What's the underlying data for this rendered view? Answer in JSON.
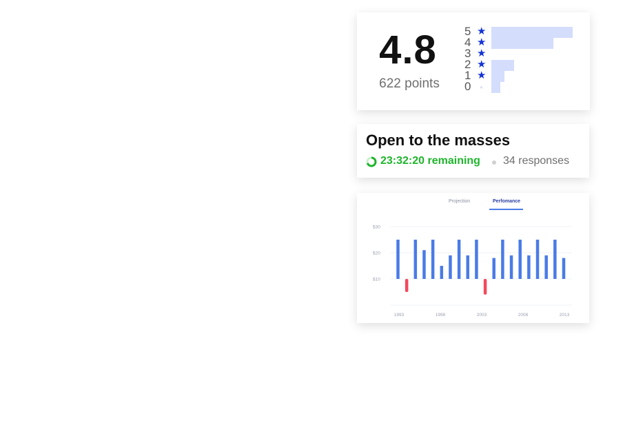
{
  "rating": {
    "score": "4.8",
    "points": "622 points",
    "rows": [
      {
        "label": "5",
        "star": "filled",
        "fraction": 1.0
      },
      {
        "label": "4",
        "star": "filled",
        "fraction": 0.76
      },
      {
        "label": "3",
        "star": "filled",
        "fraction": 0.0
      },
      {
        "label": "2",
        "star": "filled",
        "fraction": 0.28
      },
      {
        "label": "1",
        "star": "filled",
        "fraction": 0.16
      },
      {
        "label": "0",
        "star": "empty",
        "fraction": 0.11
      }
    ],
    "colors": {
      "star": "#1333d6",
      "bar": "#d4ddfb"
    }
  },
  "poll": {
    "title": "Open to the masses",
    "remaining": "23:32:20 remaining",
    "responses": "34 responses",
    "colors": {
      "remaining": "#1fb42c"
    }
  },
  "chart_tabs": {
    "projection": "Projection",
    "performance": "Perfomance",
    "active": "Perfomance"
  },
  "chart_data": {
    "type": "bar",
    "title": "",
    "xlabel": "",
    "ylabel": "",
    "x_tick_labels": [
      "1993",
      "1998",
      "2003",
      "2008",
      "2013"
    ],
    "y_tick_labels": [
      "$30",
      "$20",
      "$10"
    ],
    "y_ticks": [
      30,
      20,
      10
    ],
    "ylim": [
      0,
      32
    ],
    "baseline": 10,
    "grid": true,
    "values": [
      25,
      5,
      25,
      21,
      25,
      15,
      19,
      25,
      19,
      25,
      4,
      18,
      25,
      19,
      25,
      19,
      25,
      19,
      25,
      18
    ],
    "colors": {
      "positive": "#4a7be6",
      "negative": "#f2495c"
    }
  }
}
